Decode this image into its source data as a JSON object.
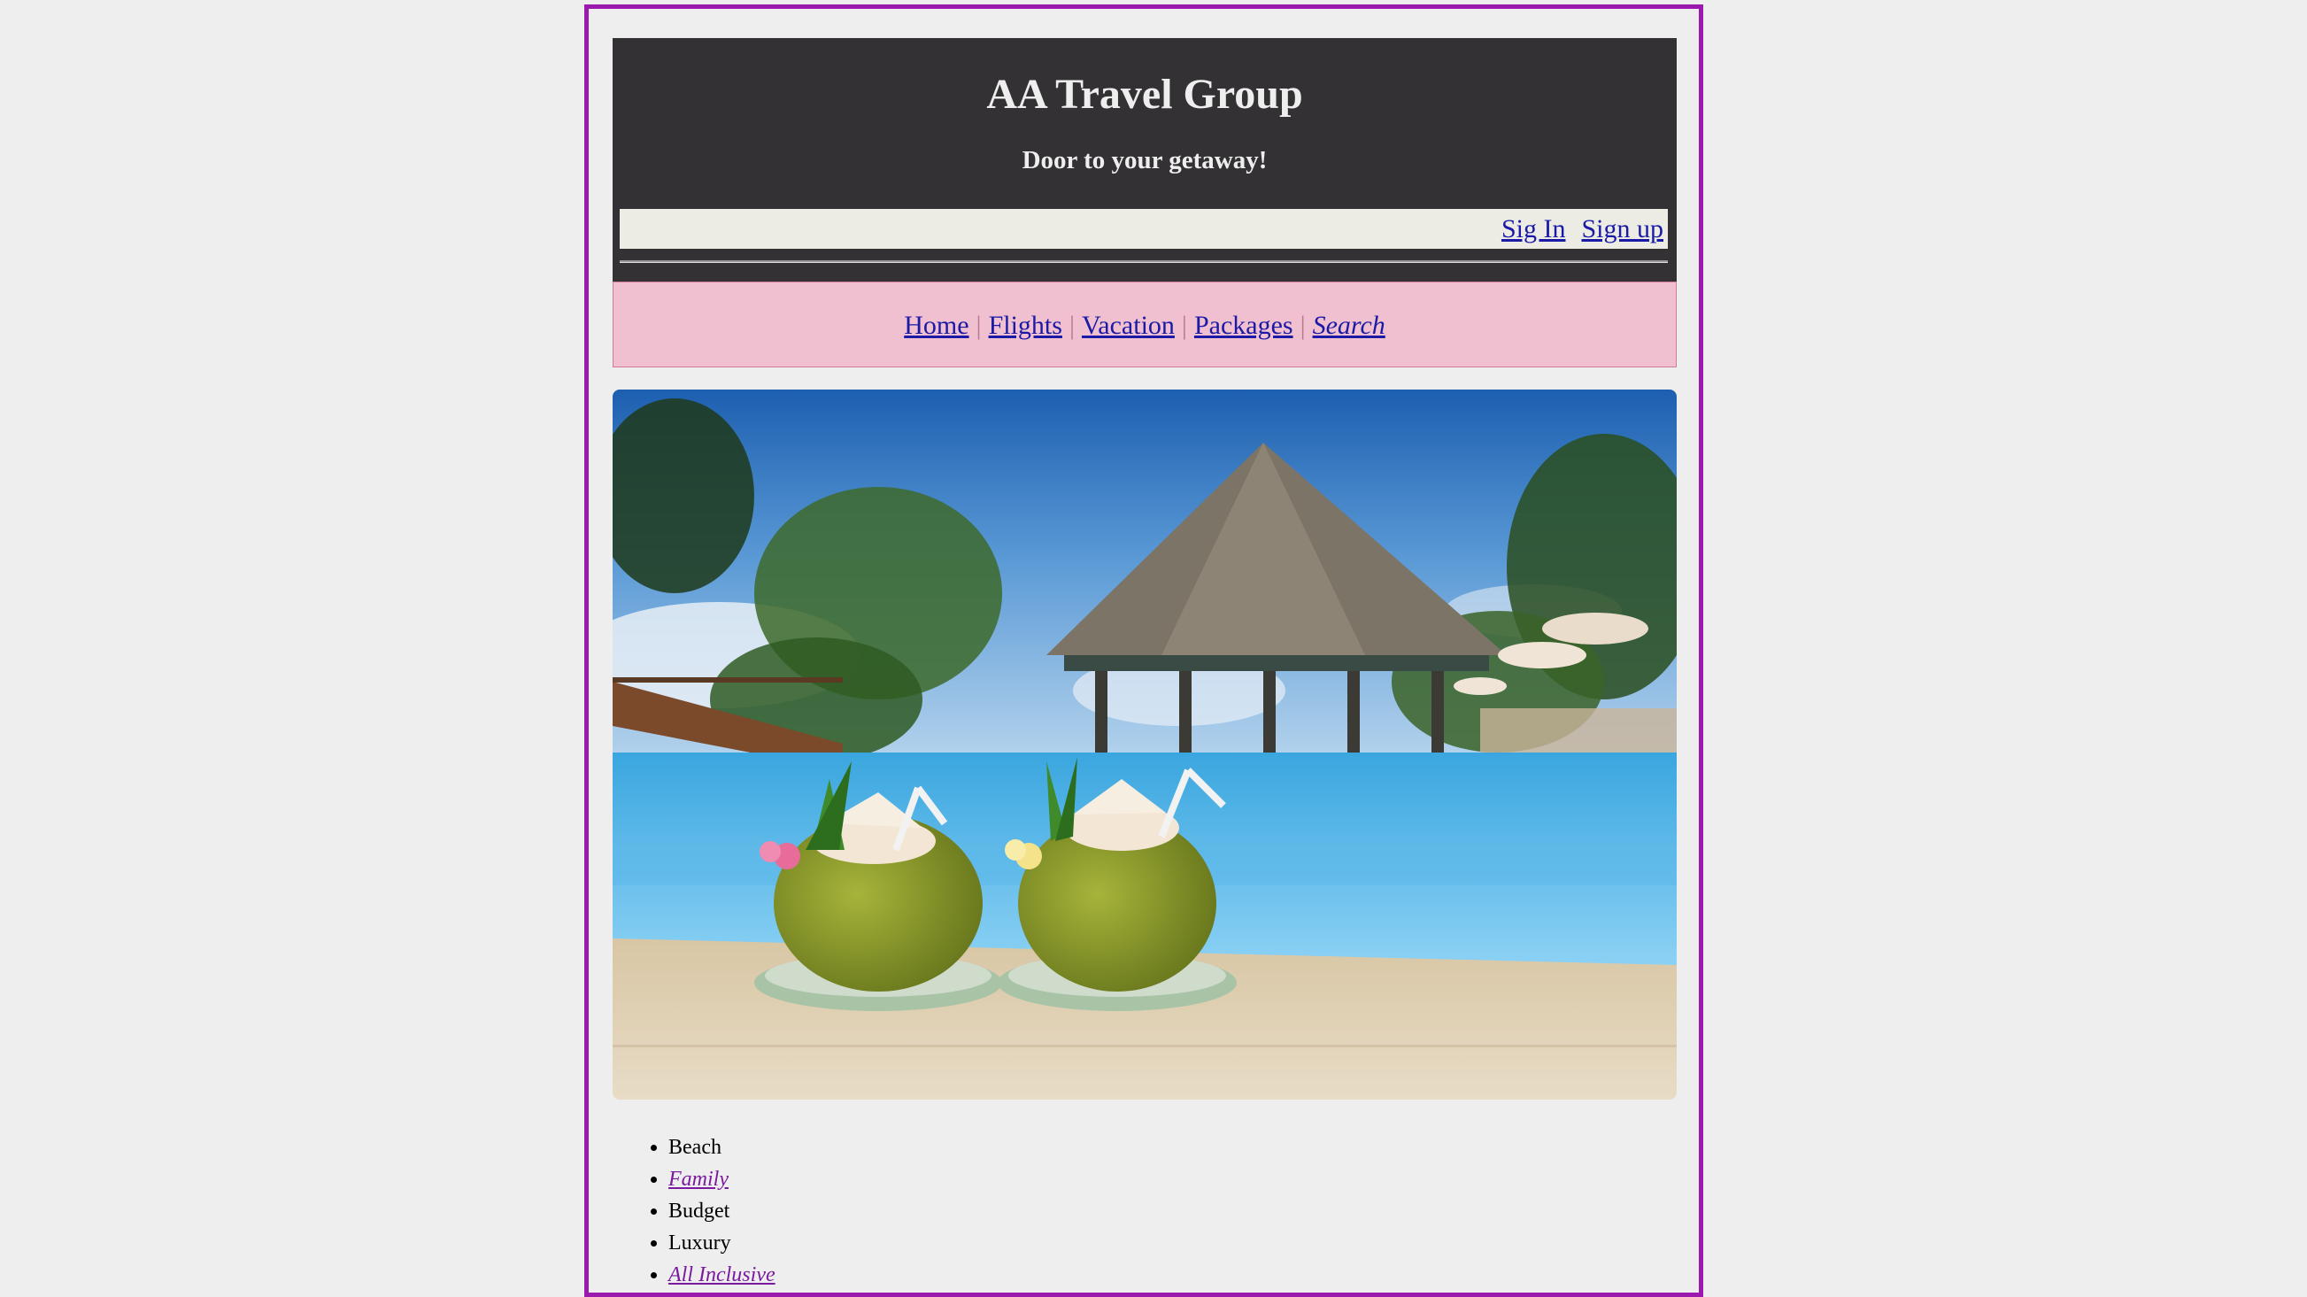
{
  "header": {
    "title": "AA Travel Group",
    "tagline": "Door to your getaway!",
    "auth": {
      "sign_in": "Sig In",
      "sign_up": "Sign up"
    }
  },
  "nav": {
    "items": [
      {
        "label": "Home",
        "style": "normal"
      },
      {
        "label": "Flights",
        "style": "normal"
      },
      {
        "label": "Vacation",
        "style": "normal"
      },
      {
        "label": "Packages",
        "style": "normal"
      },
      {
        "label": "Search",
        "style": "italic"
      }
    ],
    "separator": "|"
  },
  "hero": {
    "image": "tropical-pool-coconut-drinks-photo"
  },
  "categories": [
    {
      "label": "Beach",
      "link": false
    },
    {
      "label": "Family",
      "link": true
    },
    {
      "label": "Budget",
      "link": false
    },
    {
      "label": "Luxury",
      "link": false
    },
    {
      "label": "All Inclusive",
      "link": true
    }
  ],
  "colors": {
    "page_border": "#9a1aae",
    "header_bg": "#333133",
    "auth_bar_bg": "#ecece4",
    "nav_bg": "#f0c0d0",
    "link": "#1a1aa6",
    "visited_link": "#7a1a9e"
  }
}
